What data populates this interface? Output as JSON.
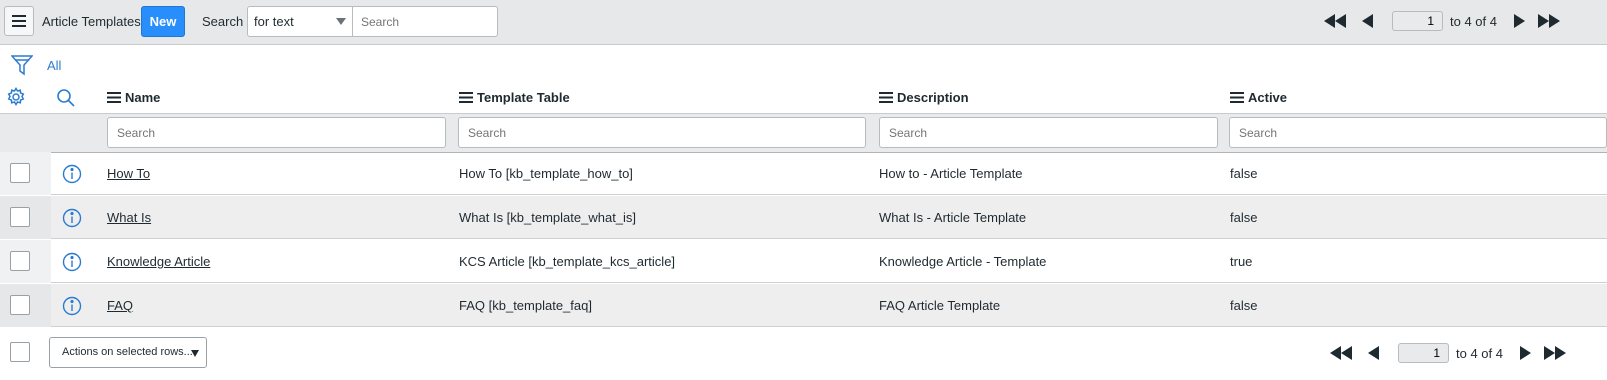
{
  "header": {
    "title": "Article Templates",
    "new_label": "New",
    "search_label": "Search",
    "search_field_selected": "for text",
    "search_placeholder": "Search",
    "pagination": {
      "page": "1",
      "range_text": "to 4 of 4"
    }
  },
  "filter": {
    "all_label": "All"
  },
  "columns": [
    {
      "label": "Name",
      "search_placeholder": "Search"
    },
    {
      "label": "Template Table",
      "search_placeholder": "Search"
    },
    {
      "label": "Description",
      "search_placeholder": "Search"
    },
    {
      "label": "Active",
      "search_placeholder": "Search"
    }
  ],
  "rows": [
    {
      "name": "How To",
      "template_table": "How To [kb_template_how_to]",
      "description": "How to - Article Template",
      "active": "false"
    },
    {
      "name": "What Is",
      "template_table": "What Is [kb_template_what_is]",
      "description": "What Is - Article Template",
      "active": "false"
    },
    {
      "name": "Knowledge Article",
      "template_table": "KCS Article [kb_template_kcs_article]",
      "description": "Knowledge Article - Template",
      "active": "true"
    },
    {
      "name": "FAQ",
      "template_table": "FAQ [kb_template_faq]",
      "description": "FAQ Article Template",
      "active": "false"
    }
  ],
  "footer": {
    "actions_label": "Actions on selected rows...",
    "pagination": {
      "page": "1",
      "range_text": "to 4 of 4"
    }
  },
  "colors": {
    "primary": "#278efc",
    "link_icon": "#2b7bd1",
    "header_bg": "#e6e8ea"
  },
  "icons": [
    "hamburger-icon",
    "filter-icon",
    "gear-icon",
    "search-icon",
    "info-icon",
    "first-page-icon",
    "previous-page-icon",
    "next-page-icon",
    "last-page-icon"
  ]
}
